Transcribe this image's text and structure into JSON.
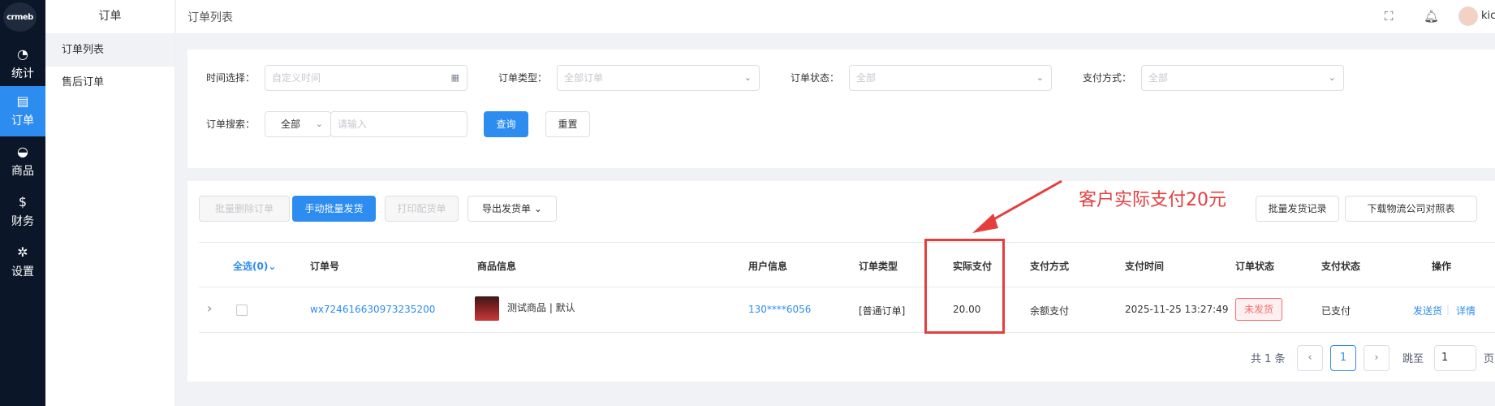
{
  "rail": {
    "logo": "crmeb",
    "items": [
      {
        "label": "统计",
        "icon": "clock-icon"
      },
      {
        "label": "订单",
        "icon": "document-icon"
      },
      {
        "label": "商品",
        "icon": "basket-icon"
      },
      {
        "label": "财务",
        "icon": "dollar-icon"
      },
      {
        "label": "设置",
        "icon": "gear-icon"
      }
    ]
  },
  "sidebar": {
    "title": "订单",
    "items": [
      {
        "label": "订单列表"
      },
      {
        "label": "售后订单"
      }
    ]
  },
  "header": {
    "breadcrumb": "订单列表",
    "username": "kic"
  },
  "filters": {
    "time_label": "时间选择：",
    "time_placeholder": "自定义时间",
    "type_label": "订单类型：",
    "type_value": "全部订单",
    "status_label": "订单状态：",
    "status_value": "全部",
    "pay_label": "支付方式：",
    "pay_value": "全部",
    "search_label": "订单搜索：",
    "search_scope": "全部",
    "search_placeholder": "请输入",
    "query_button": "查询",
    "reset_button": "重置"
  },
  "toolbar": {
    "batch_delete": "批量删除订单",
    "manual_batch_ship": "手动批量发货",
    "print_pick": "打印配货单",
    "export_ship": "导出发货单",
    "batch_ship_records": "批量发货记录",
    "download_logistics": "下载物流公司对照表"
  },
  "table": {
    "select_all": "全选(0)",
    "columns": [
      "订单号",
      "商品信息",
      "用户信息",
      "订单类型",
      "实际支付",
      "支付方式",
      "支付时间",
      "订单状态",
      "支付状态",
      "操作"
    ],
    "rows": [
      {
        "order_no": "wx724616630973235200",
        "product": "测试商品 | 默认",
        "user": "130****6056",
        "order_type": "[普通订单]",
        "paid": "20.00",
        "pay_method": "余额支付",
        "pay_time": "2025-11-25 13:27:49",
        "order_status": "未发货",
        "pay_status": "已支付",
        "action_ship": "发送货",
        "action_detail": "详情"
      }
    ]
  },
  "pager": {
    "total": "共 1 条",
    "current": "1",
    "jump_label": "跳至",
    "jump_value": "1",
    "page_suffix": "页"
  },
  "annotation": {
    "text": "客户实际支付20元",
    "color": "#e53e3e"
  },
  "colors": {
    "primary": "#2d8cf0",
    "rail_bg": "#0b1729",
    "danger": "#f56c6c"
  }
}
